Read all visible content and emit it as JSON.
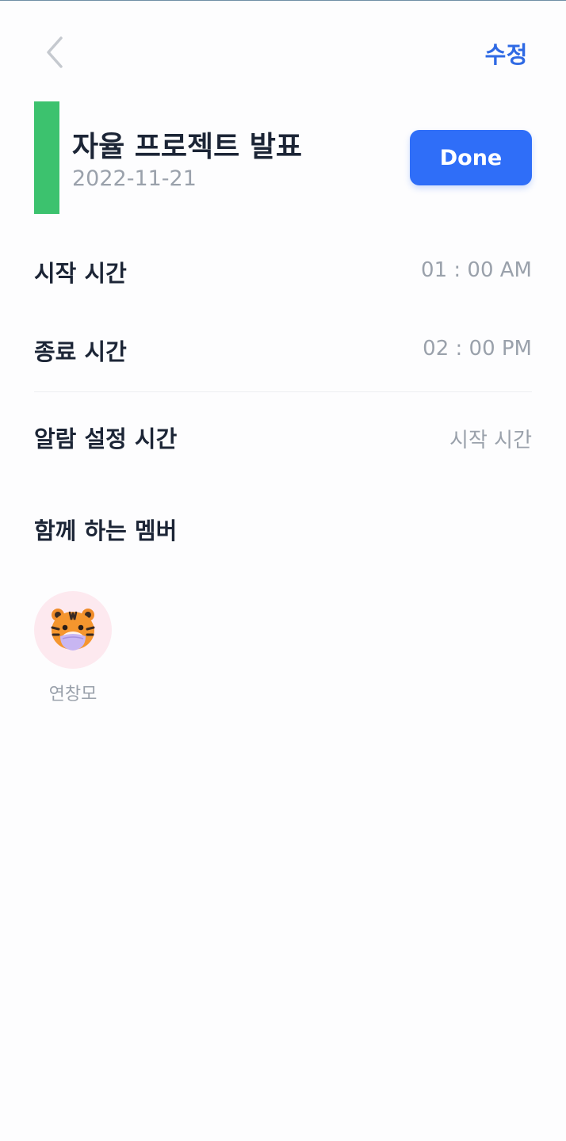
{
  "header": {
    "back_icon": "chevron-left-icon",
    "edit_label": "수정"
  },
  "event": {
    "title": "자율 프로젝트 발표",
    "date": "2022-11-21",
    "color": "#3cc26e",
    "done_label": "Done"
  },
  "times": {
    "start_label": "시작 시간",
    "start_value": "01 : 00 AM",
    "end_label": "종료 시간",
    "end_value": "02 : 00 PM"
  },
  "alarm": {
    "label": "알람 설정 시간",
    "value": "시작 시간"
  },
  "members": {
    "heading": "함께 하는 멤버",
    "list": [
      {
        "name": "연창모",
        "avatar_icon": "tiger-icon"
      }
    ]
  },
  "colors": {
    "accent": "#2f6ef8",
    "edit": "#2f6ae4",
    "event_bar": "#3cc26e"
  }
}
